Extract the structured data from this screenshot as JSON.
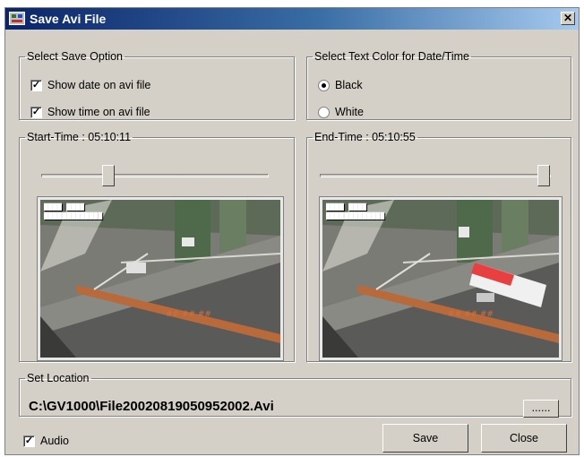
{
  "window": {
    "title": "Save Avi File",
    "close_glyph": "✕"
  },
  "save_option": {
    "legend": "Select Save Option",
    "show_date": {
      "label": "Show date on avi file",
      "checked": true
    },
    "show_time": {
      "label": "Show time on avi file",
      "checked": true
    }
  },
  "text_color": {
    "legend": "Select Text Color for Date/Time",
    "options": [
      {
        "label": "Black",
        "selected": true
      },
      {
        "label": "White",
        "selected": false
      }
    ]
  },
  "start": {
    "legend": "Start-Time : 05:10:11",
    "slider_position": 0.27
  },
  "end": {
    "legend": "End-Time : 05:10:55",
    "slider_position": 0.98
  },
  "location": {
    "legend": "Set Location",
    "path": "C:\\GV1000\\File20020819050952002.Avi",
    "browse_label": "......"
  },
  "audio": {
    "label": "Audio",
    "checked": true
  },
  "buttons": {
    "save": "Save",
    "close": "Close"
  },
  "colors": {
    "titlebar_start": "#0a246a",
    "titlebar_end": "#a6caf0",
    "dialog_bg": "#d4d0c8",
    "bus": "#e84040"
  },
  "icons": {
    "app": "app-icon",
    "check": "checkmark",
    "close": "close-x"
  }
}
